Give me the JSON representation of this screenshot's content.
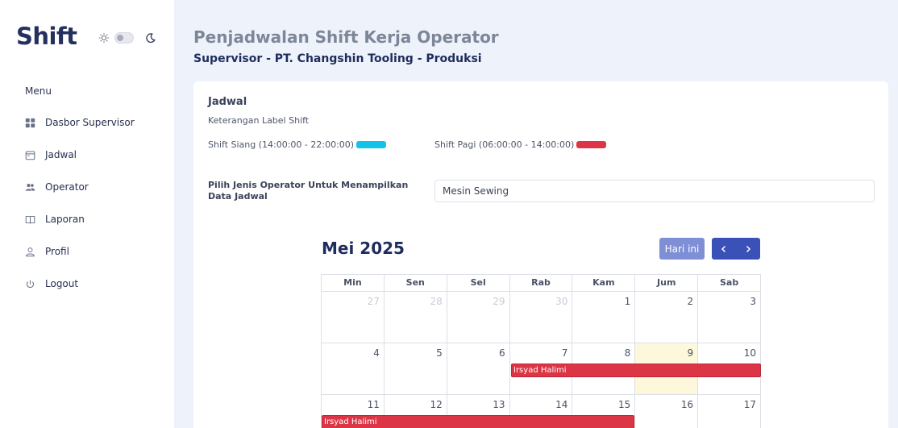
{
  "app": {
    "logo": "Shift"
  },
  "theme": {
    "sun_icon": "sun-icon",
    "moon_icon": "moon-icon",
    "dark_mode": false
  },
  "sidebar": {
    "menu_title": "Menu",
    "items": [
      {
        "label": "Dasbor Supervisor",
        "icon": "dashboard-grid-icon"
      },
      {
        "label": "Jadwal",
        "icon": "calendar-icon"
      },
      {
        "label": "Operator",
        "icon": "users-icon"
      },
      {
        "label": "Laporan",
        "icon": "book-icon"
      },
      {
        "label": "Profil",
        "icon": "user-icon"
      },
      {
        "label": "Logout",
        "icon": "power-icon"
      }
    ]
  },
  "header": {
    "title": "Penjadwalan Shift Kerja Operator",
    "subtitle": "Supervisor - PT. Changshin Tooling - Produksi"
  },
  "card": {
    "title": "Jadwal",
    "legend_title": "Keterangan Label Shift",
    "legend": [
      {
        "label": "Shift Siang (14:00:00 - 22:00:00)",
        "color": "#10c3e8"
      },
      {
        "label": "Shift Pagi (06:00:00 - 14:00:00)",
        "color": "#dc3545"
      }
    ],
    "filter_label": "Pilih Jenis Operator Untuk Menampilkan Data Jadwal",
    "filter_value": "Mesin Sewing"
  },
  "calendar": {
    "title": "Mei 2025",
    "today_label": "Hari ini",
    "days": [
      "Min",
      "Sen",
      "Sel",
      "Rab",
      "Kam",
      "Jum",
      "Sab"
    ],
    "weeks": [
      [
        "27",
        "28",
        "29",
        "30",
        "1",
        "2",
        "3"
      ],
      [
        "4",
        "5",
        "6",
        "7",
        "8",
        "9",
        "10"
      ],
      [
        "11",
        "12",
        "13",
        "14",
        "15",
        "16",
        "17"
      ]
    ],
    "events": [
      {
        "title": "Irsyad Halimi",
        "start": "2025-05-07",
        "end": "2025-05-10",
        "color": "#dc3545"
      },
      {
        "title": "Irsyad Halimi",
        "start": "2025-05-11",
        "end": "2025-05-15",
        "color": "#dc3545"
      }
    ]
  }
}
